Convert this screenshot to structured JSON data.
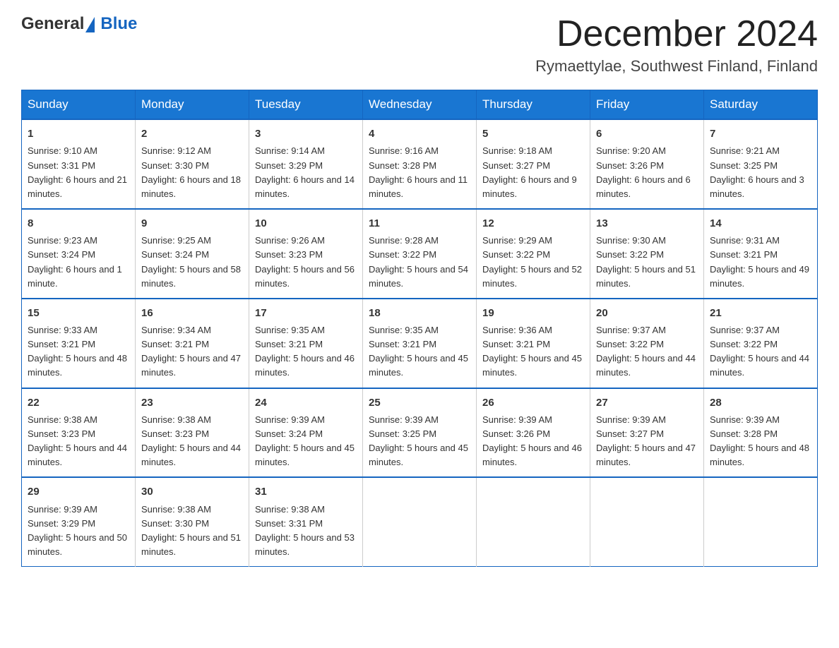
{
  "header": {
    "logo_general": "General",
    "logo_blue": "Blue",
    "month_title": "December 2024",
    "location": "Rymaettylae, Southwest Finland, Finland"
  },
  "weekdays": [
    "Sunday",
    "Monday",
    "Tuesday",
    "Wednesday",
    "Thursday",
    "Friday",
    "Saturday"
  ],
  "weeks": [
    [
      {
        "day": "1",
        "sunrise": "9:10 AM",
        "sunset": "3:31 PM",
        "daylight": "6 hours and 21 minutes."
      },
      {
        "day": "2",
        "sunrise": "9:12 AM",
        "sunset": "3:30 PM",
        "daylight": "6 hours and 18 minutes."
      },
      {
        "day": "3",
        "sunrise": "9:14 AM",
        "sunset": "3:29 PM",
        "daylight": "6 hours and 14 minutes."
      },
      {
        "day": "4",
        "sunrise": "9:16 AM",
        "sunset": "3:28 PM",
        "daylight": "6 hours and 11 minutes."
      },
      {
        "day": "5",
        "sunrise": "9:18 AM",
        "sunset": "3:27 PM",
        "daylight": "6 hours and 9 minutes."
      },
      {
        "day": "6",
        "sunrise": "9:20 AM",
        "sunset": "3:26 PM",
        "daylight": "6 hours and 6 minutes."
      },
      {
        "day": "7",
        "sunrise": "9:21 AM",
        "sunset": "3:25 PM",
        "daylight": "6 hours and 3 minutes."
      }
    ],
    [
      {
        "day": "8",
        "sunrise": "9:23 AM",
        "sunset": "3:24 PM",
        "daylight": "6 hours and 1 minute."
      },
      {
        "day": "9",
        "sunrise": "9:25 AM",
        "sunset": "3:24 PM",
        "daylight": "5 hours and 58 minutes."
      },
      {
        "day": "10",
        "sunrise": "9:26 AM",
        "sunset": "3:23 PM",
        "daylight": "5 hours and 56 minutes."
      },
      {
        "day": "11",
        "sunrise": "9:28 AM",
        "sunset": "3:22 PM",
        "daylight": "5 hours and 54 minutes."
      },
      {
        "day": "12",
        "sunrise": "9:29 AM",
        "sunset": "3:22 PM",
        "daylight": "5 hours and 52 minutes."
      },
      {
        "day": "13",
        "sunrise": "9:30 AM",
        "sunset": "3:22 PM",
        "daylight": "5 hours and 51 minutes."
      },
      {
        "day": "14",
        "sunrise": "9:31 AM",
        "sunset": "3:21 PM",
        "daylight": "5 hours and 49 minutes."
      }
    ],
    [
      {
        "day": "15",
        "sunrise": "9:33 AM",
        "sunset": "3:21 PM",
        "daylight": "5 hours and 48 minutes."
      },
      {
        "day": "16",
        "sunrise": "9:34 AM",
        "sunset": "3:21 PM",
        "daylight": "5 hours and 47 minutes."
      },
      {
        "day": "17",
        "sunrise": "9:35 AM",
        "sunset": "3:21 PM",
        "daylight": "5 hours and 46 minutes."
      },
      {
        "day": "18",
        "sunrise": "9:35 AM",
        "sunset": "3:21 PM",
        "daylight": "5 hours and 45 minutes."
      },
      {
        "day": "19",
        "sunrise": "9:36 AM",
        "sunset": "3:21 PM",
        "daylight": "5 hours and 45 minutes."
      },
      {
        "day": "20",
        "sunrise": "9:37 AM",
        "sunset": "3:22 PM",
        "daylight": "5 hours and 44 minutes."
      },
      {
        "day": "21",
        "sunrise": "9:37 AM",
        "sunset": "3:22 PM",
        "daylight": "5 hours and 44 minutes."
      }
    ],
    [
      {
        "day": "22",
        "sunrise": "9:38 AM",
        "sunset": "3:23 PM",
        "daylight": "5 hours and 44 minutes."
      },
      {
        "day": "23",
        "sunrise": "9:38 AM",
        "sunset": "3:23 PM",
        "daylight": "5 hours and 44 minutes."
      },
      {
        "day": "24",
        "sunrise": "9:39 AM",
        "sunset": "3:24 PM",
        "daylight": "5 hours and 45 minutes."
      },
      {
        "day": "25",
        "sunrise": "9:39 AM",
        "sunset": "3:25 PM",
        "daylight": "5 hours and 45 minutes."
      },
      {
        "day": "26",
        "sunrise": "9:39 AM",
        "sunset": "3:26 PM",
        "daylight": "5 hours and 46 minutes."
      },
      {
        "day": "27",
        "sunrise": "9:39 AM",
        "sunset": "3:27 PM",
        "daylight": "5 hours and 47 minutes."
      },
      {
        "day": "28",
        "sunrise": "9:39 AM",
        "sunset": "3:28 PM",
        "daylight": "5 hours and 48 minutes."
      }
    ],
    [
      {
        "day": "29",
        "sunrise": "9:39 AM",
        "sunset": "3:29 PM",
        "daylight": "5 hours and 50 minutes."
      },
      {
        "day": "30",
        "sunrise": "9:38 AM",
        "sunset": "3:30 PM",
        "daylight": "5 hours and 51 minutes."
      },
      {
        "day": "31",
        "sunrise": "9:38 AM",
        "sunset": "3:31 PM",
        "daylight": "5 hours and 53 minutes."
      },
      null,
      null,
      null,
      null
    ]
  ],
  "labels": {
    "sunrise": "Sunrise:",
    "sunset": "Sunset:",
    "daylight": "Daylight:"
  }
}
